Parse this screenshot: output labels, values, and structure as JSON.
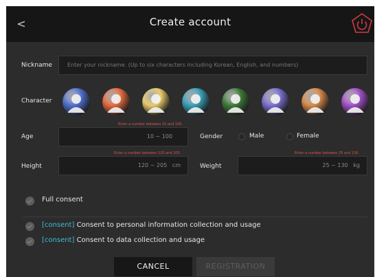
{
  "header": {
    "back_label": "<",
    "title": "Create account",
    "power_icon": "power-icon",
    "accent_color": "#d23b44"
  },
  "form": {
    "nickname_label": "Nickname",
    "nickname_placeholder": "Enter your nickname. (Up to six characters including Korean, English, and numbers)",
    "character_label": "Character",
    "characters": [
      {
        "icon": "avatar-blue-icon",
        "color": "#4f6fd0"
      },
      {
        "icon": "avatar-orange-icon",
        "color": "#e56a3d"
      },
      {
        "icon": "avatar-yellow-icon",
        "color": "#e8c96a"
      },
      {
        "icon": "avatar-teal-icon",
        "color": "#3a9fb8"
      },
      {
        "icon": "avatar-green-icon",
        "color": "#3f7a3a"
      },
      {
        "icon": "avatar-sunset-icon",
        "color": "#7a6fd0"
      },
      {
        "icon": "avatar-dusk-icon",
        "color": "#d68a4a"
      },
      {
        "icon": "avatar-purple-icon",
        "color": "#a24fc9"
      }
    ],
    "age_label": "Age",
    "age_hint": "Enter a number between 10 and 100.",
    "age_placeholder": "10 ~ 100",
    "gender_label": "Gender",
    "gender_options": [
      "Male",
      "Female"
    ],
    "height_label": "Height",
    "height_hint": "Enter a number between 120 and 205.",
    "height_placeholder": "120 ~ 205",
    "height_unit": "cm",
    "weight_label": "Weight",
    "weight_hint": "Enter a number between 25 and 130.",
    "weight_placeholder": "25 ~ 130",
    "weight_unit": "kg"
  },
  "consent": {
    "full_consent_label": "Full consent",
    "items": [
      {
        "tag": "[consent]",
        "text": "Consent to personal information collection and usage"
      },
      {
        "tag": "[consent]",
        "text": "Consent to data collection and usage"
      }
    ]
  },
  "actions": {
    "cancel_label": "CANCEL",
    "registration_label": "REGISTRATION"
  }
}
